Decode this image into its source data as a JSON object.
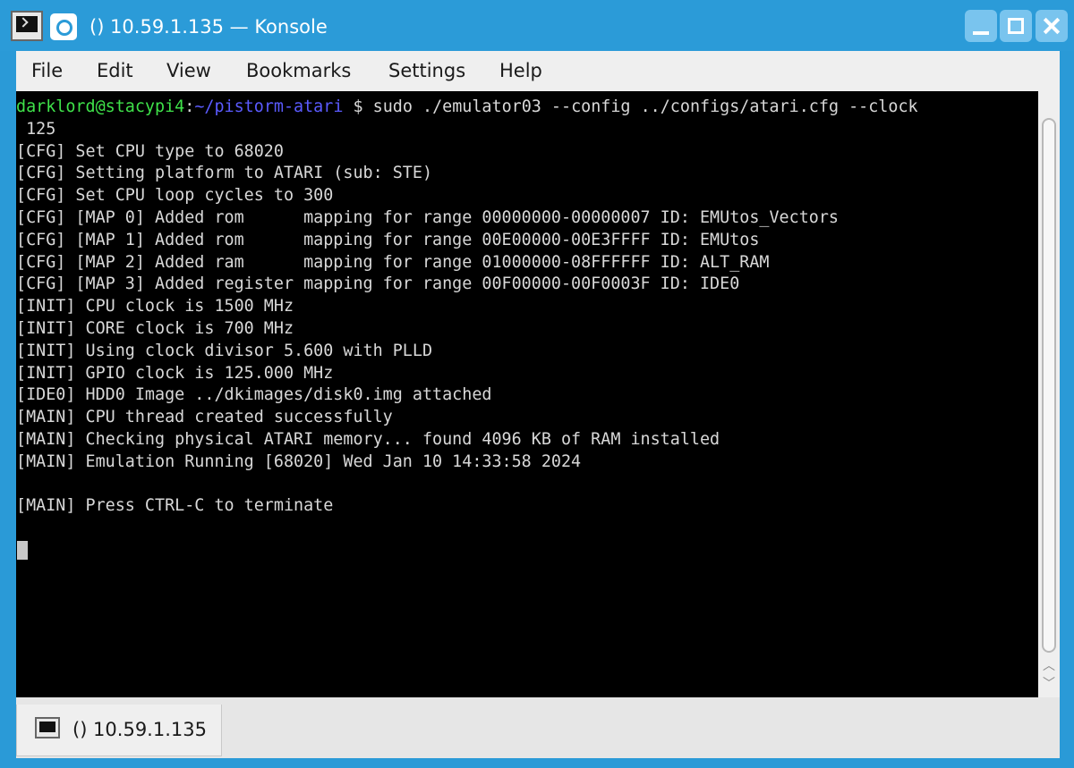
{
  "window": {
    "title": "() 10.59.1.135 — Konsole"
  },
  "menu": {
    "items": [
      "File",
      "Edit",
      "View",
      "Bookmarks",
      "Settings",
      "Help"
    ]
  },
  "terminal": {
    "prompt_user": "darklord@stacypi4",
    "prompt_sep": ":",
    "prompt_path": "~/pistorm-atari",
    "prompt_symbol": " $",
    "command": " sudo ./emulator03 --config ../configs/atari.cfg --clock",
    "lines": [
      " 125",
      "[CFG] Set CPU type to 68020",
      "[CFG] Setting platform to ATARI (sub: STE)",
      "[CFG] Set CPU loop cycles to 300",
      "[CFG] [MAP 0] Added rom      mapping for range 00000000-00000007 ID: EMUtos_Vectors",
      "[CFG] [MAP 1] Added rom      mapping for range 00E00000-00E3FFFF ID: EMUtos",
      "[CFG] [MAP 2] Added ram      mapping for range 01000000-08FFFFFF ID: ALT_RAM",
      "[CFG] [MAP 3] Added register mapping for range 00F00000-00F0003F ID: IDE0",
      "[INIT] CPU clock is 1500 MHz",
      "[INIT] CORE clock is 700 MHz",
      "[INIT] Using clock divisor 5.600 with PLLD",
      "[INIT] GPIO clock is 125.000 MHz",
      "[IDE0] HDD0 Image ../dkimages/disk0.img attached",
      "[MAIN] CPU thread created successfully",
      "[MAIN] Checking physical ATARI memory... found 4096 KB of RAM installed",
      "[MAIN] Emulation Running [68020] Wed Jan 10 14:33:58 2024",
      "",
      "[MAIN] Press CTRL-C to terminate"
    ]
  },
  "tabs": [
    {
      "label": "() 10.59.1.135",
      "icon": "terminal-icon"
    }
  ],
  "colors": {
    "titlebar": "#2b9bd8",
    "terminal_bg": "#000000",
    "terminal_fg": "#d8d8d8",
    "prompt_user": "#3fe24a",
    "prompt_path": "#5b5bff"
  }
}
